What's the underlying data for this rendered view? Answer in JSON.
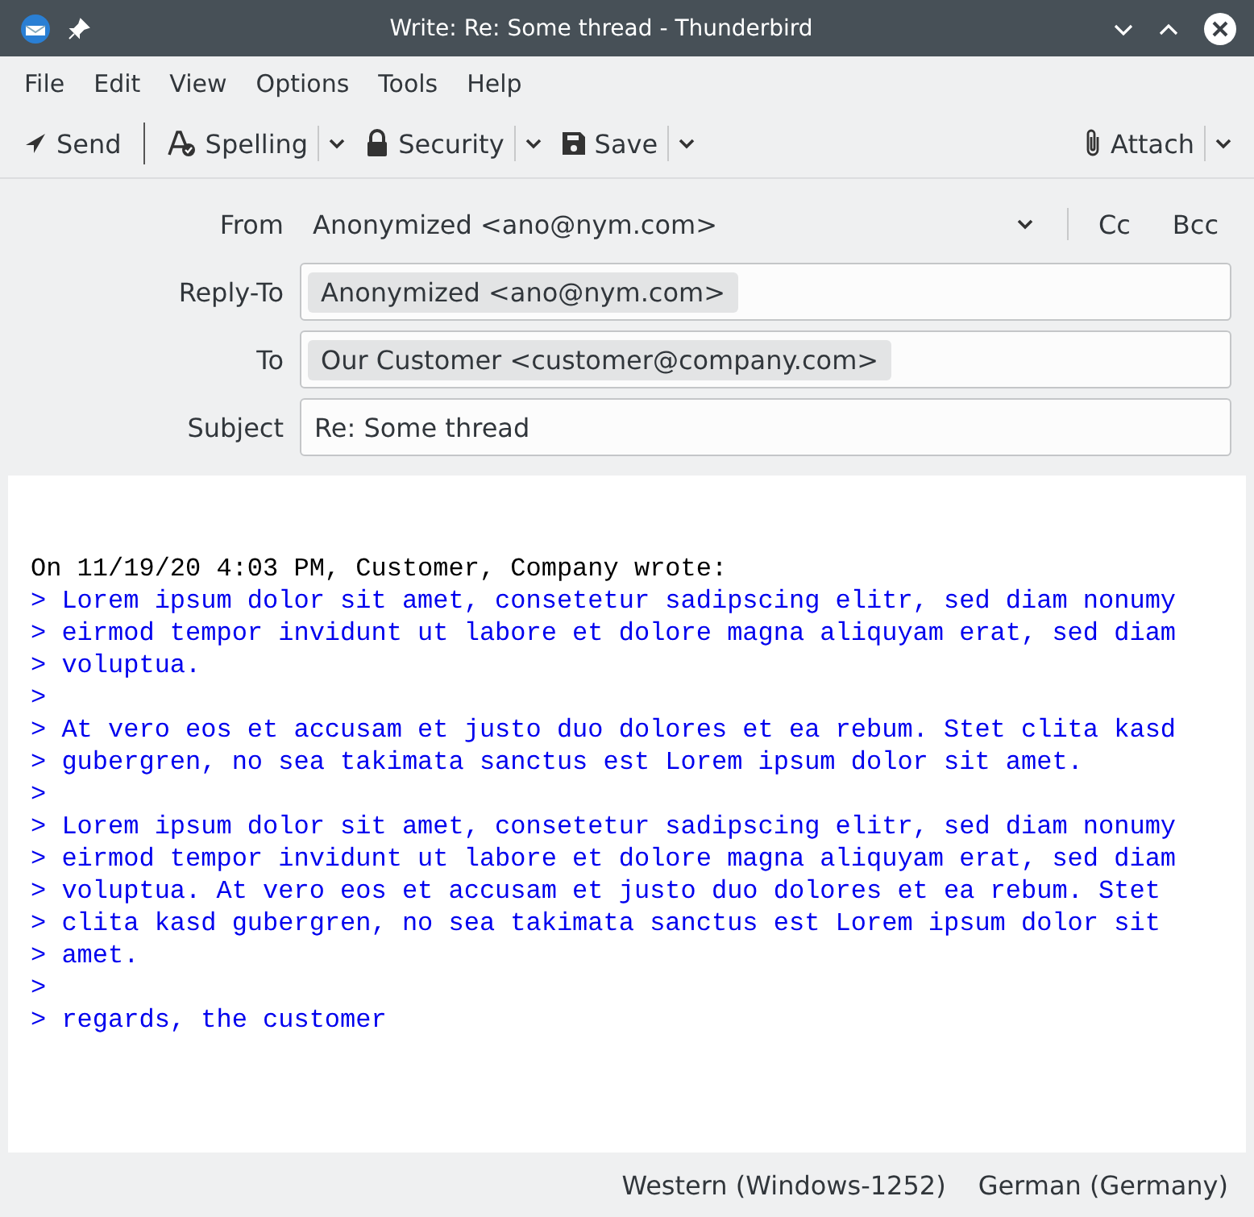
{
  "window": {
    "title": "Write: Re: Some thread - Thunderbird"
  },
  "menu": [
    "File",
    "Edit",
    "View",
    "Options",
    "Tools",
    "Help"
  ],
  "toolbar": [
    {
      "label": "Send",
      "kind": "send",
      "has_menu": false
    },
    {
      "label": "Spelling",
      "kind": "spelling",
      "has_menu": true
    },
    {
      "label": "Security",
      "kind": "security",
      "has_menu": true
    },
    {
      "label": "Save",
      "kind": "save",
      "has_menu": true
    },
    {
      "label": "Attach",
      "kind": "attach",
      "has_menu": true
    }
  ],
  "header": {
    "from": {
      "label": "From",
      "value": "Anonymized <ano@nym.com>"
    },
    "cc": "Cc",
    "bcc": "Bcc",
    "fields": [
      {
        "label": "Reply-To",
        "kind": "recipients",
        "pills": [
          "Anonymized <ano@nym.com>"
        ]
      },
      {
        "label": "To",
        "kind": "recipients",
        "pills": [
          "Our Customer <customer@company.com>"
        ]
      },
      {
        "label": "Subject",
        "kind": "text",
        "value": "Re: Some thread"
      }
    ]
  },
  "body": {
    "attribution": "On 11/19/20 4:03 PM, Customer, Company wrote:",
    "quote_lines": [
      "> Lorem ipsum dolor sit amet, consetetur sadipscing elitr, sed diam nonumy",
      "> eirmod tempor invidunt ut labore et dolore magna aliquyam erat, sed diam",
      "> voluptua.",
      ">",
      "> At vero eos et accusam et justo duo dolores et ea rebum. Stet clita kasd",
      "> gubergren, no sea takimata sanctus est Lorem ipsum dolor sit amet.",
      ">",
      "> Lorem ipsum dolor sit amet, consetetur sadipscing elitr, sed diam nonumy",
      "> eirmod tempor invidunt ut labore et dolore magna aliquyam erat, sed diam",
      "> voluptua. At vero eos et accusam et justo duo dolores et ea rebum. Stet",
      "> clita kasd gubergren, no sea takimata sanctus est Lorem ipsum dolor sit",
      "> amet.",
      ">",
      "> regards, the customer"
    ]
  },
  "status_bar": [
    "Western (Windows-1252)",
    "German (Germany)"
  ]
}
